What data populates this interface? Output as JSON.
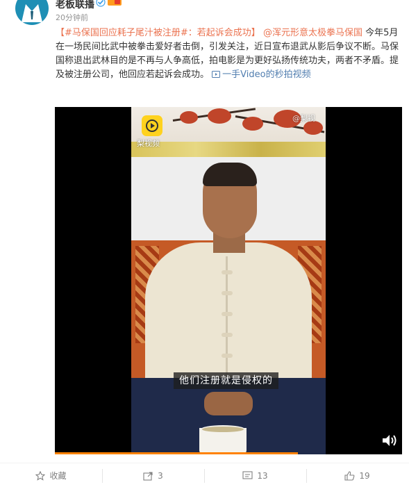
{
  "post": {
    "author": "老板联播",
    "time": "20分钟前",
    "hashtag": "【#马保国回应耗子尾汁被注册#：若起诉会成功】",
    "mention": "@浑元形意太极拳马保国",
    "text_line1_tail": "今年",
    "text_body": "5月在一场民间比武中被拳击爱好者击倒，引发关注，近日宣布退武从影后争议不断。马保国称退出武林目的是不再与人争高低，拍电影是为更好弘扬传统功夫，两者不矛盾。提及被注册公司，他回应若起诉会成功。",
    "video_link": "一手Video的秒拍视频"
  },
  "video": {
    "brand_text": "梨视频",
    "watermark": "@梨视",
    "subtitle": "他们注册就是侵权的",
    "progress": 0.7
  },
  "actions": {
    "collect_label": "收藏",
    "repost_count": "3",
    "comment_count": "13",
    "like_count": "19"
  },
  "icons": {
    "avatar": "suit-avatar-icon",
    "verified": "verified-icon",
    "vip": "vip-badge-icon",
    "video_link": "video-link-icon",
    "play": "play-icon",
    "volume": "volume-icon",
    "collect": "star-icon",
    "repost": "repost-icon",
    "comment": "comment-icon",
    "like": "thumb-up-icon"
  },
  "colors": {
    "hashtag": "#eb7350",
    "link": "#507daf",
    "progress": "#ff8200"
  }
}
